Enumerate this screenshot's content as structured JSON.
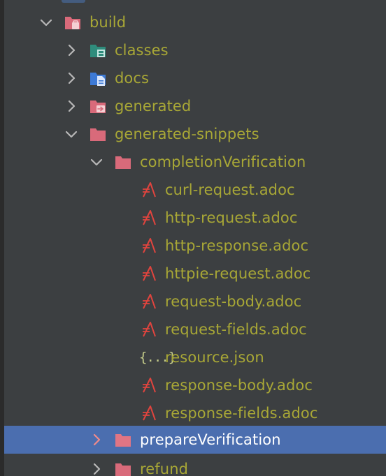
{
  "tree": {
    "build": {
      "label": "build",
      "icon": "build-folder-icon",
      "expanded": true
    },
    "classes": {
      "label": "classes",
      "icon": "classes-folder-icon"
    },
    "docs": {
      "label": "docs",
      "icon": "docs-folder-icon"
    },
    "generated": {
      "label": "generated",
      "icon": "generated-folder-icon"
    },
    "generated_snippets": {
      "label": "generated-snippets",
      "icon": "folder-icon",
      "expanded": true
    },
    "completion_verification": {
      "label": "completionVerification",
      "icon": "folder-icon",
      "expanded": true
    },
    "files": [
      {
        "label": "curl-request.adoc",
        "icon": "asciidoc-icon"
      },
      {
        "label": "http-request.adoc",
        "icon": "asciidoc-icon"
      },
      {
        "label": "http-response.adoc",
        "icon": "asciidoc-icon"
      },
      {
        "label": "httpie-request.adoc",
        "icon": "asciidoc-icon"
      },
      {
        "label": "request-body.adoc",
        "icon": "asciidoc-icon"
      },
      {
        "label": "request-fields.adoc",
        "icon": "asciidoc-icon"
      },
      {
        "label": "resource.json",
        "icon": "json-icon",
        "glyph": "{...}"
      },
      {
        "label": "response-body.adoc",
        "icon": "asciidoc-icon"
      },
      {
        "label": "response-fields.adoc",
        "icon": "asciidoc-icon"
      }
    ],
    "prepare_verification": {
      "label": "prepareVerification",
      "icon": "folder-icon",
      "selected": true
    },
    "refund": {
      "label": "refund",
      "icon": "folder-icon"
    }
  },
  "colors": {
    "background": "#3c3f41",
    "text": "#a8a736",
    "selection": "#4b6eaf",
    "folder": "#d96a7a",
    "asciidoc": "#e0443e"
  }
}
